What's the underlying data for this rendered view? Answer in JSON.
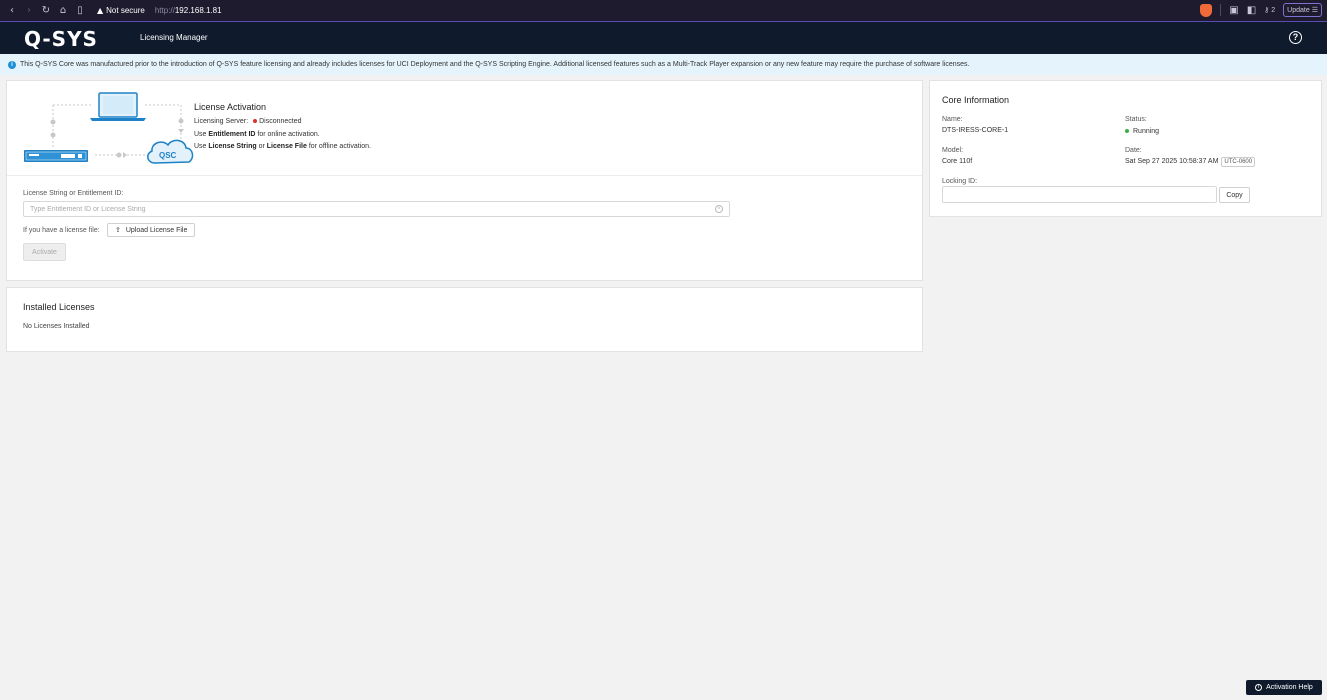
{
  "browser": {
    "security_label": "Not secure",
    "url_protocol": "http://",
    "url_host": "192.168.1.81",
    "extension_count": "2",
    "update_label": "Update"
  },
  "header": {
    "logo_text": "Q-SYS",
    "app_title": "Licensing Manager"
  },
  "banner": {
    "message": "This Q-SYS Core was manufactured prior to the introduction of Q-SYS feature licensing and already includes licenses for UCI Deployment and the Q-SYS Scripting Engine. Additional licensed features such as a Multi-Track Player expansion or any new feature may require the purchase of software licenses."
  },
  "activation": {
    "title": "License Activation",
    "server_label": "Licensing Server:",
    "server_status": "Disconnected",
    "online_prefix": "Use",
    "online_term": "Entitlement ID",
    "online_suffix": "for online activation.",
    "offline_prefix": "Use",
    "offline_term1": "License String",
    "offline_or": "or",
    "offline_term2": "License File",
    "offline_suffix": "for offline activation.",
    "field_label": "License String or Entitlement ID:",
    "placeholder": "Type Entitlement ID or License String",
    "upload_prompt": "If you have a license file:",
    "upload_button": "Upload License File",
    "activate_button": "Activate",
    "illustration_cloud_label": "QSC"
  },
  "core_info": {
    "title": "Core Information",
    "name_label": "Name:",
    "name_value": "DTS-IRESS-CORE-1",
    "status_label": "Status:",
    "status_value": "Running",
    "model_label": "Model:",
    "model_value": "Core 110f",
    "date_label": "Date:",
    "date_value": "Sat Sep 27 2025 10:58:37 AM",
    "timezone": "UTC-0600",
    "locking_label": "Locking ID:",
    "locking_value": "",
    "copy_button": "Copy"
  },
  "installed": {
    "title": "Installed Licenses",
    "empty_text": "No Licenses Installed"
  },
  "help": {
    "button_label": "Activation Help"
  },
  "colors": {
    "header_bg": "#0f1a2c",
    "banner_bg": "#e5f4fc",
    "status_disconnected": "#e03030",
    "status_running": "#3cb043",
    "illustration_blue": "#1e82c8"
  }
}
